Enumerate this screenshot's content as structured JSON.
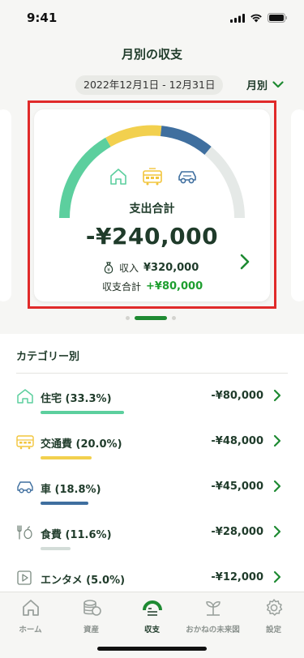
{
  "status_bar": {
    "time": "9:41"
  },
  "header": {
    "title": "月別の収支",
    "date_range": "2022年12月1日 - 12月31日",
    "period_label": "月別"
  },
  "summary_card": {
    "expense_label": "支出合計",
    "expense_total": "-¥240,000",
    "income_label": "収入",
    "income_value": "¥320,000",
    "balance_label": "収支合計",
    "balance_value": "+¥80,000",
    "gauge_segments": [
      {
        "category": "住宅",
        "share": 0.333,
        "color": "#5ccf9e"
      },
      {
        "category": "交通費",
        "share": 0.2,
        "color": "#f2d04e"
      },
      {
        "category": "車",
        "share": 0.188,
        "color": "#3f6f9f"
      },
      {
        "category": "残り",
        "share": 0.279,
        "color": "#e5e9e7"
      }
    ]
  },
  "carousel": {
    "pages": 3,
    "active": 1
  },
  "categories": {
    "title": "カテゴリー別",
    "items": [
      {
        "label": "住宅 (33.3%)",
        "amount": "-¥80,000",
        "icon": "house-icon",
        "color": "#5ccf9e",
        "share": 0.333
      },
      {
        "label": "交通費 (20.0%)",
        "amount": "-¥48,000",
        "icon": "train-icon",
        "color": "#f2d04e",
        "share": 0.2
      },
      {
        "label": "車 (18.8%)",
        "amount": "-¥45,000",
        "icon": "car-icon",
        "color": "#3f6f9f",
        "share": 0.188
      },
      {
        "label": "食費 (11.6%)",
        "amount": "-¥28,000",
        "icon": "food-icon",
        "color": "#d3dcd8",
        "share": 0.116
      },
      {
        "label": "エンタメ (5.0%)",
        "amount": "-¥12,000",
        "icon": "play-icon",
        "color": "#d3dcd8",
        "share": 0.05
      }
    ]
  },
  "tab_bar": {
    "tabs": [
      {
        "label": "ホーム",
        "icon": "home-icon"
      },
      {
        "label": "資産",
        "icon": "coins-icon"
      },
      {
        "label": "収支",
        "icon": "gauge-icon"
      },
      {
        "label": "おかねの未来図",
        "icon": "sprout-icon"
      },
      {
        "label": "設定",
        "icon": "gear-icon"
      }
    ],
    "active": 2
  },
  "colors": {
    "accent": "#1e8a32",
    "text_dark": "#1f3b2a",
    "positive": "#1e9e2f",
    "highlight": "#e02a2a"
  }
}
